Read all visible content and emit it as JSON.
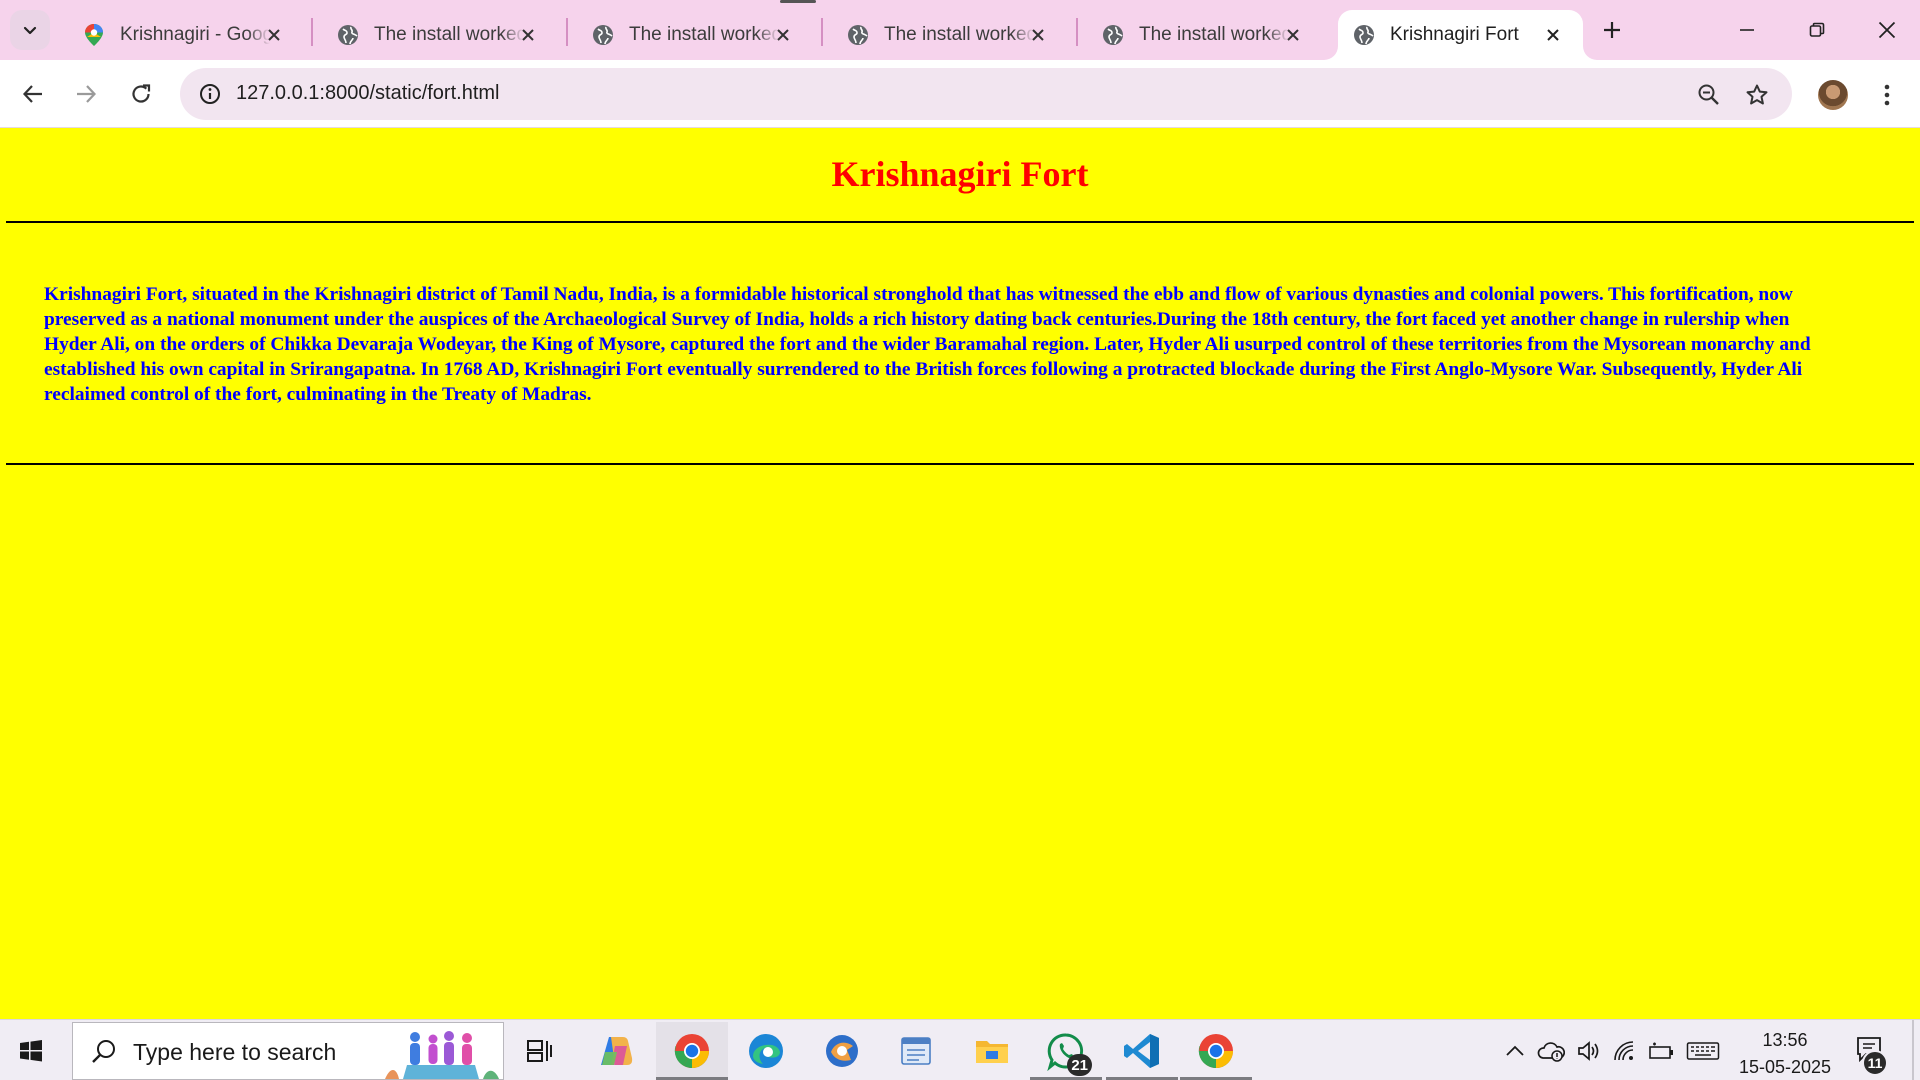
{
  "browser": {
    "tabs": [
      {
        "title": "Krishnagiri - Google Maps",
        "favicon": "google-maps-icon",
        "active": false
      },
      {
        "title": "The install worked successfully!",
        "favicon": "globe-icon",
        "active": false
      },
      {
        "title": "The install worked successfully!",
        "favicon": "globe-icon",
        "active": false
      },
      {
        "title": "The install worked successfully!",
        "favicon": "globe-icon",
        "active": false
      },
      {
        "title": "The install worked successfully!",
        "favicon": "globe-icon",
        "active": false
      },
      {
        "title": "Krishnagiri Fort",
        "favicon": "globe-icon",
        "active": true
      }
    ],
    "address": "127.0.0.1:8000/static/fort.html"
  },
  "page": {
    "title": "Krishnagiri Fort",
    "body": "Krishnagiri Fort, situated in the Krishnagiri district of Tamil Nadu, India, is a formidable historical stronghold that has witnessed the ebb and flow of various dynasties and colonial powers. This fortification, now preserved as a national monument under the auspices of the Archaeological Survey of India, holds a rich history dating back centuries.During the 18th century, the fort faced yet another change in rulership when Hyder Ali, on the orders of Chikka Devaraja Wodeyar, the King of Mysore, captured the fort and the wider Baramahal region. Later, Hyder Ali usurped control of these territories from the Mysorean monarchy and established his own capital in Srirangapatna. In 1768 AD, Krishnagiri Fort eventually surrendered to the British forces following a protracted blockade during the First Anglo-Mysore War. Subsequently, Hyder Ali reclaimed control of the fort, culminating in the Treaty of Madras.",
    "colors": {
      "background": "#ffff00",
      "title": "#ff0000",
      "body": "#0000ff"
    }
  },
  "taskbar": {
    "search_placeholder": "Type here to search",
    "apps": [
      {
        "name": "task-view-icon"
      },
      {
        "name": "copilot-icon"
      },
      {
        "name": "chrome-icon",
        "active": true
      },
      {
        "name": "edge-icon"
      },
      {
        "name": "app-icon"
      },
      {
        "name": "notepad-icon"
      },
      {
        "name": "file-explorer-icon"
      },
      {
        "name": "whatsapp-icon",
        "badge": "21"
      },
      {
        "name": "vscode-icon"
      },
      {
        "name": "chrome-icon"
      }
    ],
    "time": "13:56",
    "date": "15-05-2025",
    "notification_count": "11"
  }
}
